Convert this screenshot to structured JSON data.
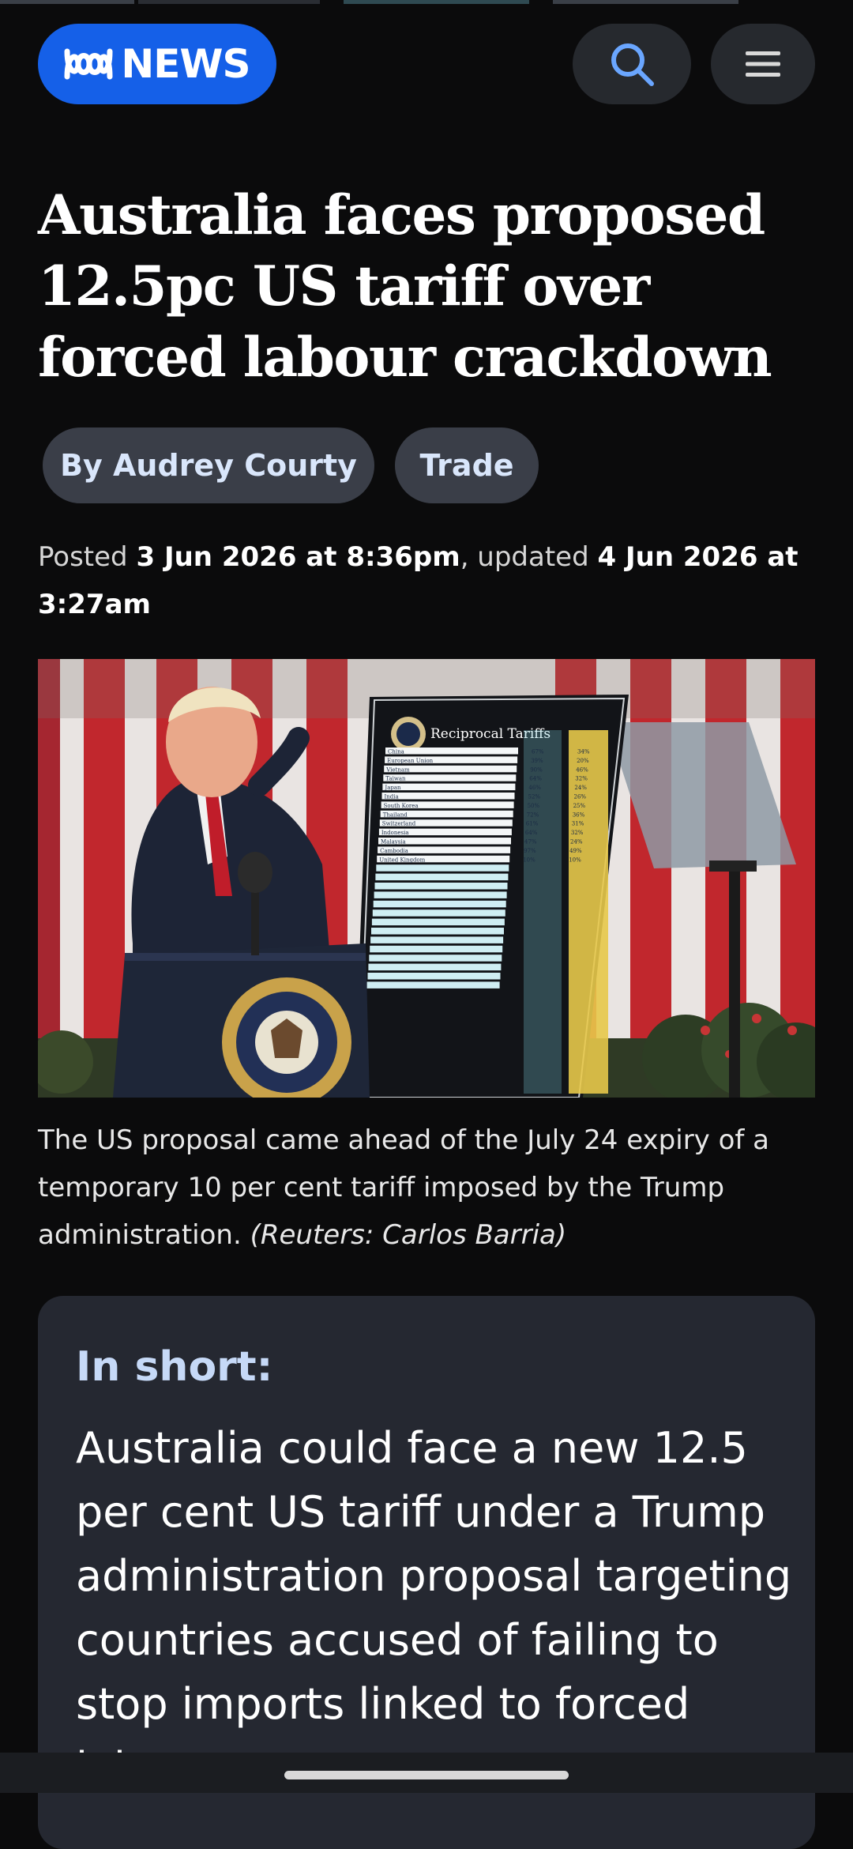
{
  "logo": {
    "text": "NEWS",
    "brand_color": "#1560e8",
    "mark_icon": "abc-lissajous-icon"
  },
  "header": {
    "search_icon": "search-icon",
    "menu_icon": "hamburger-menu-icon"
  },
  "article": {
    "headline": "Australia faces proposed 12.5pc US tariff over forced labour crackdown",
    "author_label": "By Audrey Courty",
    "topic_label": "Trade",
    "posted_prefix": "Posted ",
    "posted_date": "3 Jun 2026 at 8:36pm",
    "updated_prefix": ", updated ",
    "updated_date": "4 Jun 2026 at 3:27am"
  },
  "photo": {
    "board_title": "Reciprocal Tariffs",
    "board_countries": [
      "China",
      "European Union",
      "Vietnam",
      "Taiwan",
      "Japan",
      "India",
      "South Korea",
      "Thailand",
      "Switzerland",
      "Indonesia",
      "Malaysia",
      "Cambodia",
      "United Kingdom"
    ],
    "board_charged": [
      "67%",
      "39%",
      "90%",
      "64%",
      "46%",
      "52%",
      "50%",
      "72%",
      "61%",
      "64%",
      "47%",
      "97%",
      "10%"
    ],
    "board_reciprocal": [
      "34%",
      "20%",
      "46%",
      "32%",
      "24%",
      "26%",
      "25%",
      "36%",
      "31%",
      "32%",
      "24%",
      "49%",
      "10%"
    ]
  },
  "caption": {
    "text": "The US proposal came ahead of the July 24 expiry of a temporary 10 per cent tariff imposed by the Trump administration. ",
    "credit": "(Reuters: Carlos Barria)"
  },
  "in_short": {
    "title": "In short:",
    "text": "Australia could face a new 12.5 per cent US tariff under a Trump administration proposal targeting countries accused of failing to stop imports linked to forced labour."
  }
}
